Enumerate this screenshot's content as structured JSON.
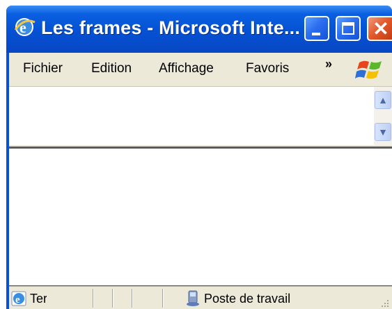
{
  "window": {
    "title": "Les frames - Microsoft Inte...",
    "controls": {
      "minimize": "minimize",
      "maximize": "maximize",
      "close": "✕"
    }
  },
  "menubar": {
    "items": [
      "Fichier",
      "Edition",
      "Affichage",
      "Favoris"
    ],
    "overflow": "»"
  },
  "statusbar": {
    "text": "Ter",
    "zone": "Poste de travail"
  },
  "icons": {
    "app": "ie-icon",
    "logo": "windows-logo-icon",
    "page": "ie-page-icon",
    "zone": "computer-icon"
  },
  "colors": {
    "titlebar": "#0551d4",
    "chrome": "#ece9d8",
    "close": "#e35a2c"
  }
}
